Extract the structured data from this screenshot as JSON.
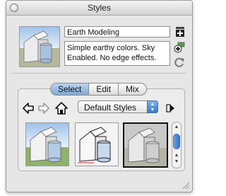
{
  "window": {
    "title": "Styles"
  },
  "style": {
    "name": "Earth Modeling",
    "description": "Simple earthy colors. Sky Enabled.  No edge effects."
  },
  "tabs": [
    {
      "label": "Select",
      "active": true
    },
    {
      "label": "Edit",
      "active": false
    },
    {
      "label": "Mix",
      "active": false
    }
  ],
  "library": {
    "selected": "Default Styles"
  },
  "icons": {
    "close": "close-icon",
    "create_style": "create-style-icon",
    "update_style": "update-style-icon",
    "back": "back-arrow-icon",
    "forward": "forward-arrow-icon",
    "home": "home-icon",
    "details": "details-arrow-icon",
    "resize": "resize-grip-icon"
  },
  "colors": {
    "tab_active": "#8fb6e0",
    "scroll_thumb": "#3a78c6"
  }
}
